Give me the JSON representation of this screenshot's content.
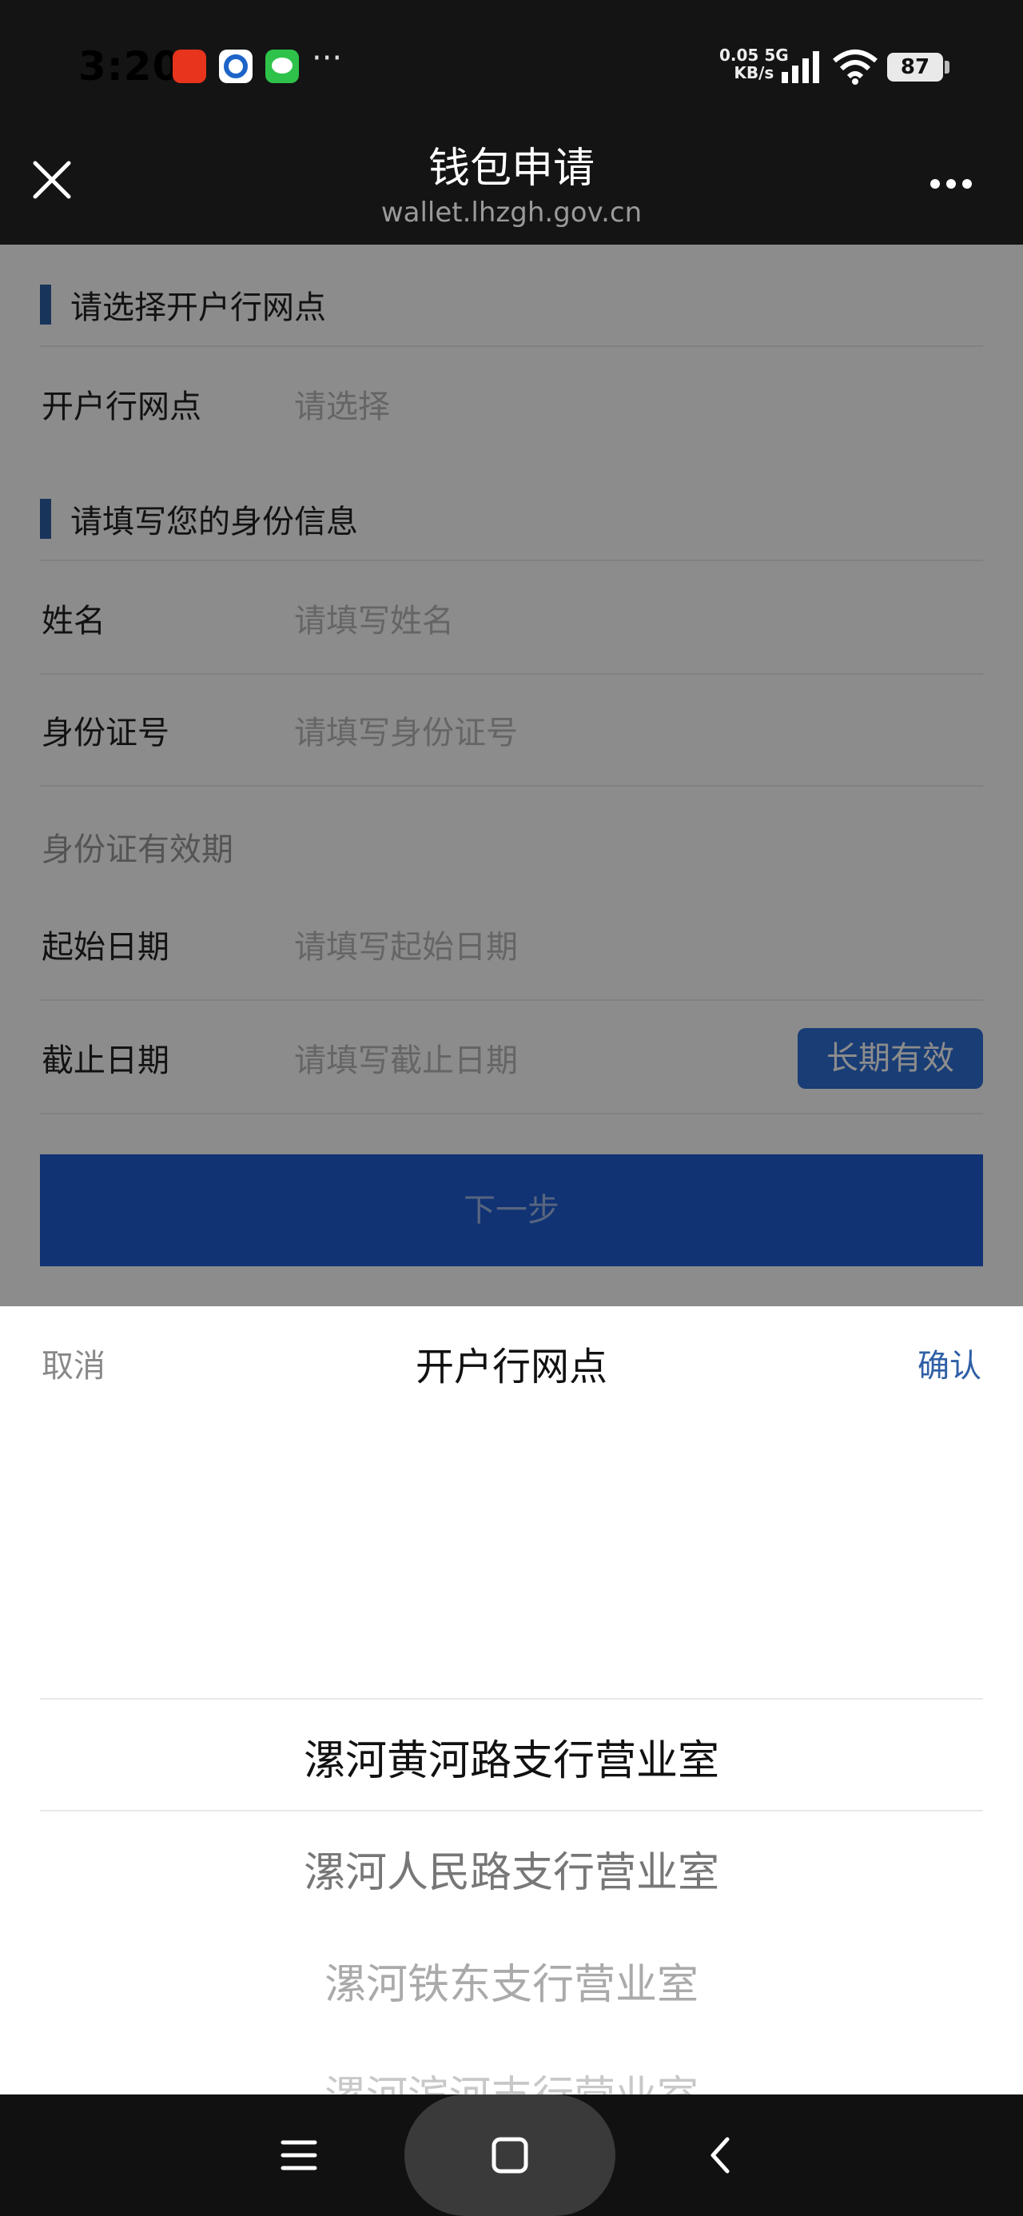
{
  "status_bar": {
    "time": "3:20",
    "net_speed_value": "0.05",
    "net_speed_unit": "KB/s",
    "network": "5G",
    "battery": "87",
    "more_indicator": "···"
  },
  "header": {
    "title": "钱包申请",
    "url": "wallet.lhzgh.gov.cn"
  },
  "form": {
    "section_branch_title": "请选择开户行网点",
    "branch_label": "开户行网点",
    "branch_placeholder": "请选择",
    "section_identity_title": "请填写您的身份信息",
    "name_label": "姓名",
    "name_placeholder": "请填写姓名",
    "id_label": "身份证号",
    "id_placeholder": "请填写身份证号",
    "validity_label": "身份证有效期",
    "start_label": "起始日期",
    "start_placeholder": "请填写起始日期",
    "end_label": "截止日期",
    "end_placeholder": "请填写截止日期",
    "longterm_button": "长期有效",
    "next_button": "下一步"
  },
  "picker": {
    "cancel": "取消",
    "title": "开户行网点",
    "confirm": "确认",
    "options": [
      "漯河黄河路支行营业室",
      "漯河人民路支行营业室",
      "漯河铁东支行营业室",
      "漯河滨河支行营业室"
    ]
  },
  "colors": {
    "accent": "#2f5fa6",
    "primary_button": "#1f5ed4"
  }
}
